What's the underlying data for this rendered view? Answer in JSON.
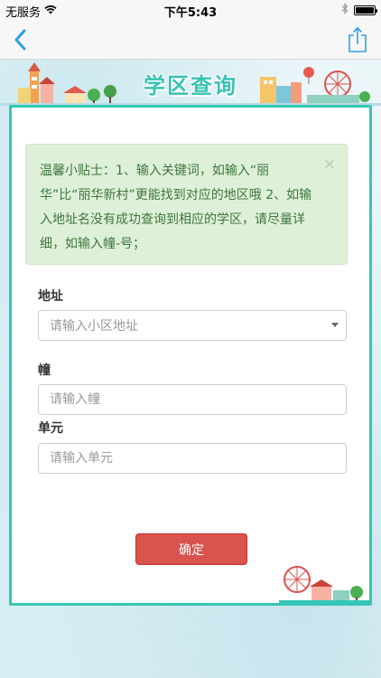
{
  "status_bar": {
    "carrier": "无服务",
    "time": "下午5:43"
  },
  "nav": {
    "back_icon": "chevron-left-icon",
    "share_icon": "share-icon"
  },
  "banner": {
    "title": "学区查询"
  },
  "tip": {
    "text": "温馨小贴士：1、输入关键词，如输入“丽华”比“丽华新村”更能找到对应的地区哦 2、如输入地址名没有成功查询到相应的学区，请尽量详细，如输入幢-号；",
    "close_symbol": "×"
  },
  "form": {
    "address_label": "地址",
    "address_placeholder": "请输入小区地址",
    "building_label": "幢",
    "building_placeholder": "请输入幢",
    "unit_label": "单元",
    "unit_placeholder": "请输入单元",
    "submit_label": "确定"
  },
  "colors": {
    "accent": "#35c6b5",
    "button": "#d9534f",
    "tip_bg": "#dff0d8",
    "tip_text": "#3c763d",
    "ios_blue": "#2f9ee8"
  }
}
